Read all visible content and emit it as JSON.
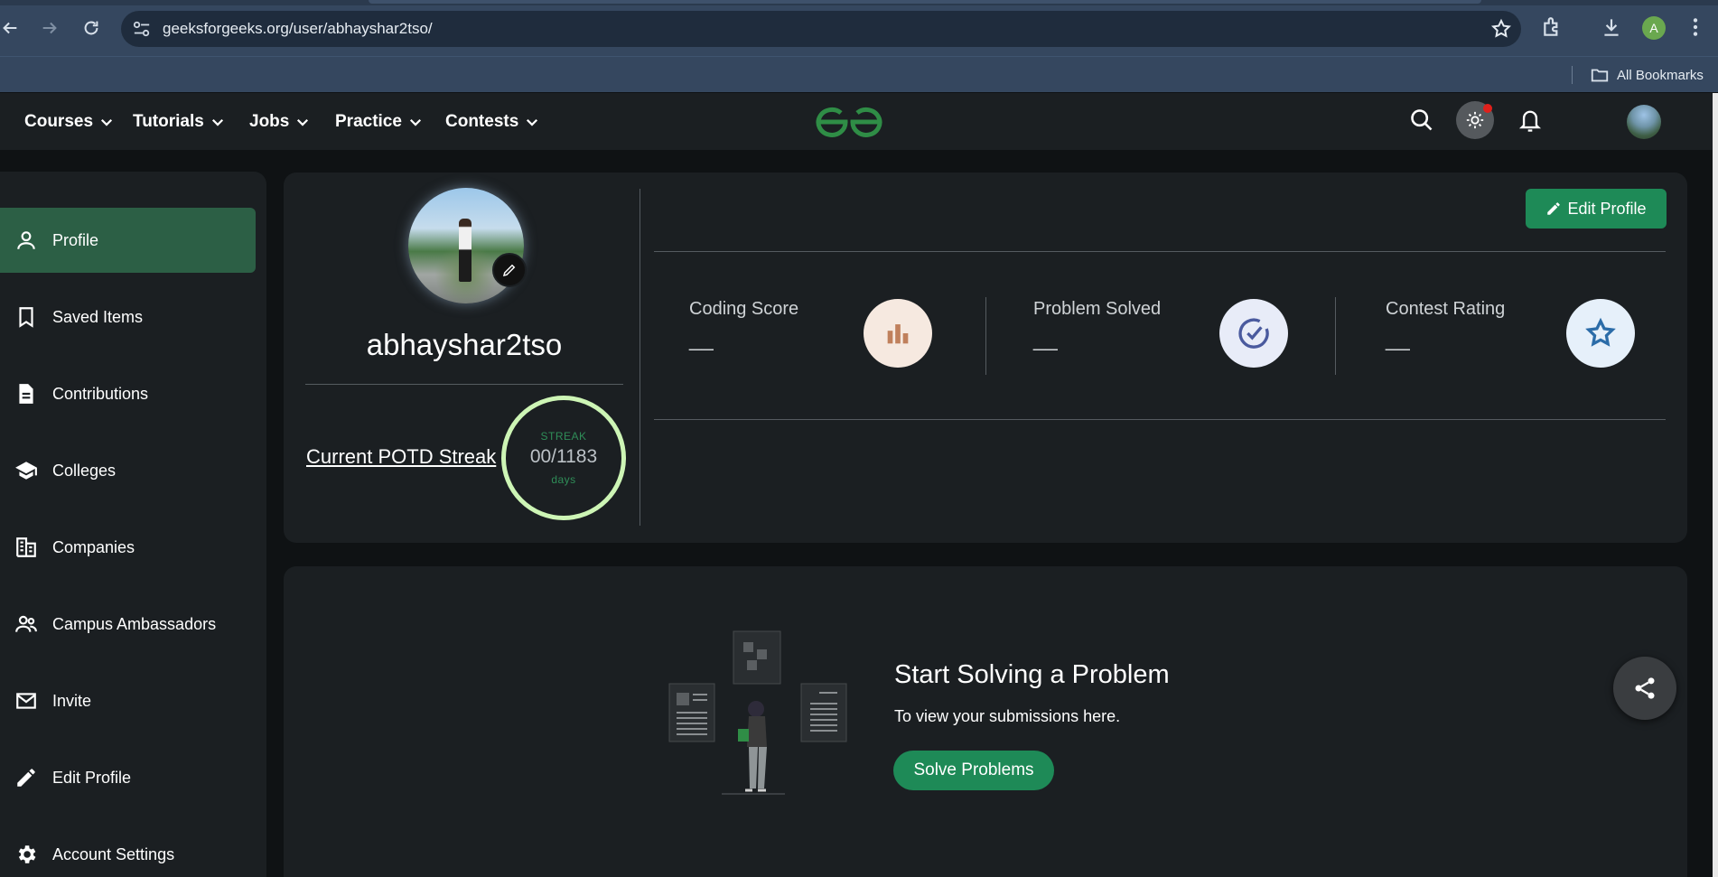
{
  "browser": {
    "url": "geeksforgeeks.org/user/abhayshar2tso/",
    "profile_initial": "A",
    "bookmarks_label": "All Bookmarks"
  },
  "header": {
    "menu": [
      {
        "label": "Courses"
      },
      {
        "label": "Tutorials"
      },
      {
        "label": "Jobs"
      },
      {
        "label": "Practice"
      },
      {
        "label": "Contests"
      }
    ],
    "brand_color": "#2f8d46"
  },
  "sidebar": {
    "items": [
      {
        "label": "Profile",
        "icon": "person-icon",
        "active": true
      },
      {
        "label": "Saved Items",
        "icon": "bookmark-icon"
      },
      {
        "label": "Contributions",
        "icon": "document-icon"
      },
      {
        "label": "Colleges",
        "icon": "graduation-cap-icon"
      },
      {
        "label": "Companies",
        "icon": "building-icon"
      },
      {
        "label": "Campus Ambassadors",
        "icon": "people-icon"
      },
      {
        "label": "Invite",
        "icon": "mail-icon"
      },
      {
        "label": "Edit Profile",
        "icon": "pencil-icon"
      },
      {
        "label": "Account Settings",
        "icon": "gear-icon"
      }
    ]
  },
  "profile": {
    "username": "abhayshar2tso",
    "potd_label": "Current POTD Streak",
    "streak": {
      "top": "STREAK",
      "value": "00/1183",
      "unit": "days"
    },
    "edit_button": "Edit Profile",
    "stats": [
      {
        "label": "Coding Score",
        "value": "__",
        "icon": "bar-chart-icon",
        "icon_bg": "#f6e9e0",
        "icon_color": "#c0805c"
      },
      {
        "label": "Problem Solved",
        "value": "__",
        "icon": "check-circle-icon",
        "icon_bg": "#e8ecf8",
        "icon_color": "#4a5a9e"
      },
      {
        "label": "Contest Rating",
        "value": "__",
        "icon": "star-icon",
        "icon_bg": "#e6f0fa",
        "icon_color": "#2b6ca8"
      }
    ]
  },
  "problems": {
    "title": "Start Solving a Problem",
    "subtitle": "To view your submissions here.",
    "button": "Solve Problems"
  },
  "colors": {
    "accent_green": "#1e8a57",
    "active_sidebar": "#2c5f45",
    "streak_ring": "#cdf5b5"
  }
}
